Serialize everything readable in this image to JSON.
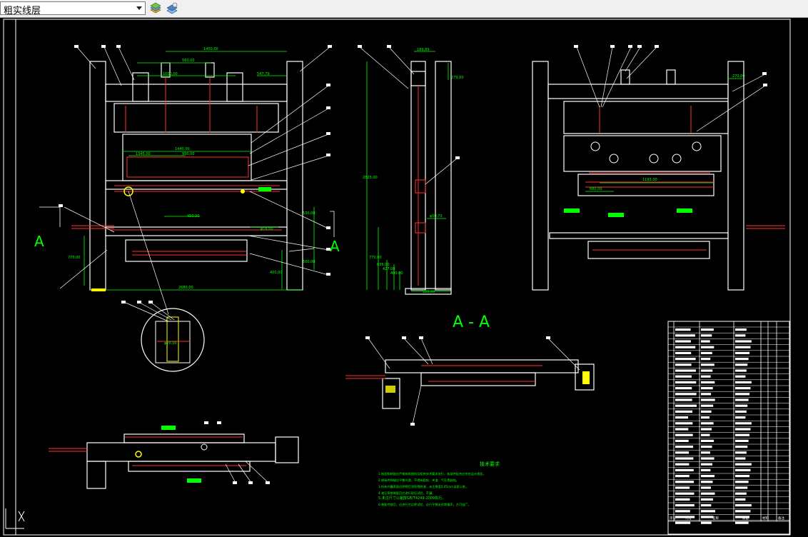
{
  "toolbar": {
    "layer_name": "粗实线层",
    "layer_dropdown": "chevron-down-icon",
    "buttons": [
      "layer-properties-icon",
      "layer-states-icon"
    ]
  },
  "drawing": {
    "section_label": "A - A",
    "cut_mark_left": "A",
    "cut_mark_right": "A",
    "front_dims": {
      "top_width": "1450,00",
      "left_a": "560,00",
      "left_b": "1000,00",
      "right_a": "547,79",
      "inner_w": "1440,00",
      "inner_w2": "1345,00",
      "inner_w3": "930,00",
      "press": "450,00",
      "base_h": "770,00",
      "base_w": "2680,00",
      "side_h": "400,00",
      "side_h2": "500,00",
      "side_r": "530,00",
      "phi": "φ16,00"
    },
    "side_dims": {
      "top_a": "189,89",
      "top_b": "279,00",
      "height": "2823,00",
      "phi": "φ50,73",
      "low_a": "770,00",
      "low_b": "635,00",
      "low_c": "427,00",
      "low_d": "400,00",
      "base": "520,00"
    },
    "right_dims": {
      "top": "270,00",
      "mid": "1193,00",
      "mid2": "680,00"
    },
    "detail_dim": "φ70,00",
    "tech_req": {
      "title": "技术要求",
      "lines": [
        "1.制造和装配应严格按照图纸及相关技术要求进行，各部件配合应符合设计规定。",
        "2.焊接件焊缝应平整光滑，不得有裂纹、夹渣、气孔等缺陷。",
        "3.所有外露表面应除锈后涂防锈底漆，未注厚度0.05mm误差公差。",
        "4.液压系统装配后应进行耐压试验，不漏。",
        "5.未注尺寸公差按GB/T4249-2009执行。",
        "6.装配完成后，应进行空运转试验，运行平稳无异常噪声，方可出厂。"
      ]
    },
    "title_block": {
      "footer": [
        "序号",
        "代号",
        "名称",
        "数量",
        "材料",
        "备注"
      ]
    }
  }
}
